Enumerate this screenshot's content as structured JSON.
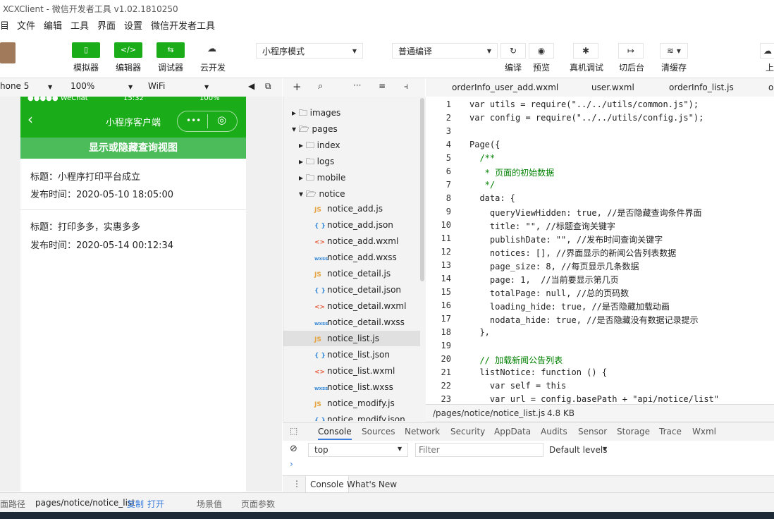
{
  "window": {
    "title": "XCXClient - 微信开发者工具 v1.02.1810250"
  },
  "menu": [
    "目",
    "文件",
    "编辑",
    "工具",
    "界面",
    "设置",
    "微信开发者工具"
  ],
  "toolbar": {
    "simulator": "模拟器",
    "editor": "编辑器",
    "debugger": "调试器",
    "cloud": "云开发",
    "mode": "小程序模式",
    "compile_mode": "普通编译",
    "compile": "编译",
    "preview": "预览",
    "remote_debug": "真机调试",
    "background": "切后台",
    "clear_cache": "清缓存",
    "upload": "上"
  },
  "device": {
    "model": "hone 5",
    "zoom": "100%",
    "network": "WiFi"
  },
  "phone": {
    "status_carrier": "●●●●● WeChat",
    "status_time": "15:32",
    "status_battery": "100%",
    "nav_title": "小程序客户端",
    "toggle_label": "显示或隐藏查询视图",
    "notices": [
      {
        "title": "标题：小程序打印平台成立",
        "date": "发布时间：2020-05-10 18:05:00"
      },
      {
        "title": "标题：打印多多，实惠多多",
        "date": "发布时间：2020-05-14 00:12:34"
      }
    ]
  },
  "tree": [
    {
      "name": "images",
      "type": "folder-closed"
    },
    {
      "name": "pages",
      "type": "folder-open"
    },
    {
      "name": "index",
      "type": "folder-closed"
    },
    {
      "name": "logs",
      "type": "folder-closed"
    },
    {
      "name": "mobile",
      "type": "folder-closed"
    },
    {
      "name": "notice",
      "type": "folder-open"
    },
    {
      "name": "notice_add.js",
      "type": "js"
    },
    {
      "name": "notice_add.json",
      "type": "json"
    },
    {
      "name": "notice_add.wxml",
      "type": "wxml"
    },
    {
      "name": "notice_add.wxss",
      "type": "wxss"
    },
    {
      "name": "notice_detail.js",
      "type": "js"
    },
    {
      "name": "notice_detail.json",
      "type": "json"
    },
    {
      "name": "notice_detail.wxml",
      "type": "wxml"
    },
    {
      "name": "notice_detail.wxss",
      "type": "wxss"
    },
    {
      "name": "notice_list.js",
      "type": "js"
    },
    {
      "name": "notice_list.json",
      "type": "json"
    },
    {
      "name": "notice_list.wxml",
      "type": "wxml"
    },
    {
      "name": "notice_list.wxss",
      "type": "wxss"
    },
    {
      "name": "notice_modify.js",
      "type": "js"
    },
    {
      "name": "notice_modify.json",
      "type": "json"
    }
  ],
  "tabs": [
    "orderInfo_user_add.wxml",
    "user.wxml",
    "orderInfo_list.js",
    "o"
  ],
  "code": [
    "var utils = require(\"../../utils/common.js\");",
    "var config = require(\"../../utils/config.js\");",
    "",
    "Page({",
    "  /**",
    "   * 页面的初始数据",
    "   */",
    "  data: {",
    "    queryViewHidden: true, //是否隐藏查询条件界面",
    "    title: \"\", //标题查询关键字",
    "    publishDate: \"\", //发布时间查询关键字",
    "    notices: [], //界面显示的新闻公告列表数据",
    "    page_size: 8, //每页显示几条数据",
    "    page: 1,  //当前要显示第几页",
    "    totalPage: null, //总的页码数",
    "    loading_hide: true, //是否隐藏加载动画",
    "    nodata_hide: true, //是否隐藏没有数据记录提示",
    "  },",
    "",
    "  // 加载新闻公告列表",
    "  listNotice: function () {",
    "    var self = this",
    "    var url = config.basePath + \"api/notice/list\""
  ],
  "line_numbers": [
    "1",
    "2",
    "3",
    "4",
    "5",
    "6",
    "7",
    "8",
    "9",
    "10",
    "11",
    "12",
    "13",
    "14",
    "15",
    "16",
    "17",
    "18",
    "19",
    "20",
    "21",
    "22",
    "23"
  ],
  "file_path": "/pages/notice/notice_list.js",
  "file_size": "4.8 KB",
  "devtools_tabs": [
    "Console",
    "Sources",
    "Network",
    "Security",
    "AppData",
    "Audits",
    "Sensor",
    "Storage",
    "Trace",
    "Wxml"
  ],
  "console": {
    "context": "top",
    "filter_placeholder": "Filter",
    "levels": "Default levels",
    "drawer_tabs": [
      "Console",
      "What's New"
    ]
  },
  "bottom": {
    "path_label": "面路径",
    "path": "pages/notice/notice_list",
    "copy": "复制",
    "open": "打开",
    "scene": "场景值",
    "params": "页面参数"
  }
}
